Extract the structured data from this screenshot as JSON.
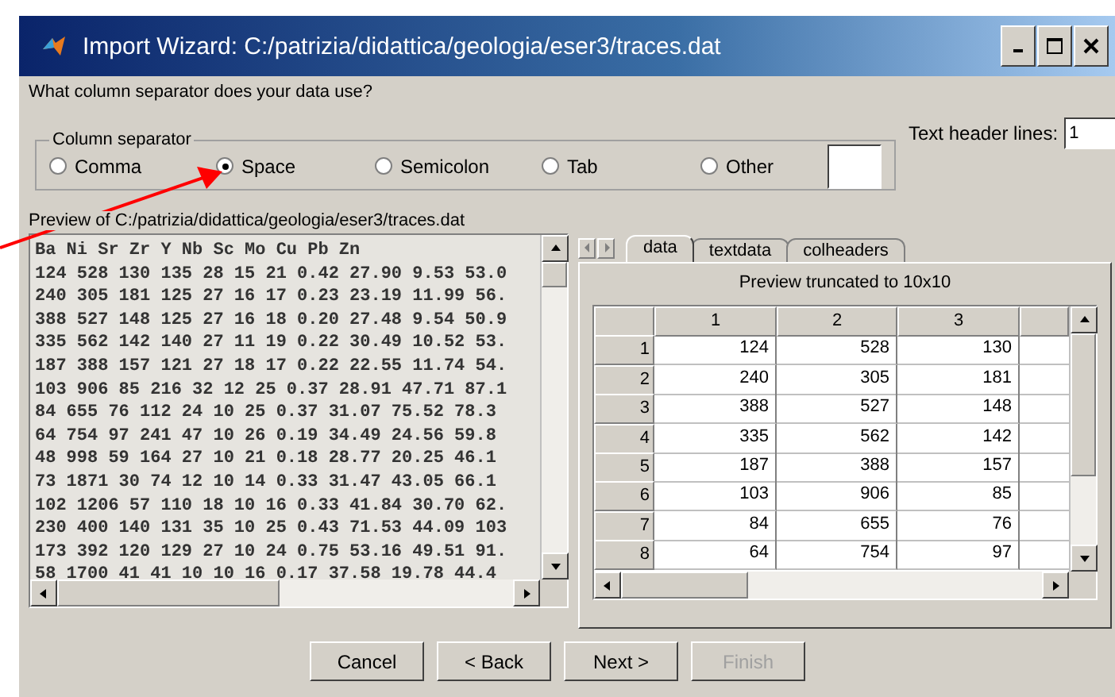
{
  "window": {
    "title": "Import Wizard: C:/patrizia/didattica/geologia/eser3/traces.dat"
  },
  "question": "What column separator does your data use?",
  "separator": {
    "label": "Column separator",
    "options": [
      {
        "label": "Comma",
        "selected": false
      },
      {
        "label": "Space",
        "selected": true
      },
      {
        "label": "Semicolon",
        "selected": false
      },
      {
        "label": "Tab",
        "selected": false
      },
      {
        "label": "Other",
        "selected": false
      }
    ]
  },
  "header_lines": {
    "label": "Text header lines:",
    "value": "1"
  },
  "preview": {
    "label": "Preview of C:/patrizia/didattica/geologia/eser3/traces.dat",
    "lines": [
      "Ba Ni Sr Zr Y Nb Sc Mo Cu Pb Zn",
      "124 528 130 135 28 15 21 0.42 27.90 9.53 53.0",
      "240 305 181 125 27 16 17 0.23 23.19 11.99 56.",
      "388 527 148 125 27 16 18 0.20 27.48 9.54 50.9",
      "335 562 142 140 27 11 19 0.22 30.49 10.52 53.",
      "187 388 157 121 27 18 17 0.22 22.55 11.74 54.",
      "103 906 85 216 32 12 25 0.37 28.91 47.71 87.1",
      "84 655 76 112 24 10 25 0.37 31.07 75.52 78.3",
      "64 754 97 241 47 10 26 0.19 34.49 24.56 59.8",
      "48 998 59 164 27 10 21 0.18 28.77 20.25 46.1",
      "73 1871 30 74 12 10 14 0.33 31.47 43.05 66.1",
      "102 1206 57 110 18 10 16 0.33 41.84 30.70 62.",
      "230 400 140 131 35 10 25 0.43 71.53 44.09 103",
      "173 392 120 129 27 10 24 0.75 53.16 49.51 91.",
      "58 1700 41 41 10 10 16 0.17 37.58 19.78 44.4"
    ]
  },
  "tabs": [
    {
      "label": "data",
      "selected": true
    },
    {
      "label": "textdata",
      "selected": false
    },
    {
      "label": "colheaders",
      "selected": false
    }
  ],
  "table": {
    "caption": "Preview truncated to 10x10",
    "columns": [
      "1",
      "2",
      "3"
    ],
    "rows": [
      {
        "header": "1",
        "cells": [
          "124",
          "528",
          "130"
        ]
      },
      {
        "header": "2",
        "cells": [
          "240",
          "305",
          "181"
        ]
      },
      {
        "header": "3",
        "cells": [
          "388",
          "527",
          "148"
        ]
      },
      {
        "header": "4",
        "cells": [
          "335",
          "562",
          "142"
        ]
      },
      {
        "header": "5",
        "cells": [
          "187",
          "388",
          "157"
        ]
      },
      {
        "header": "6",
        "cells": [
          "103",
          "906",
          "85"
        ]
      },
      {
        "header": "7",
        "cells": [
          "84",
          "655",
          "76"
        ]
      },
      {
        "header": "8",
        "cells": [
          "64",
          "754",
          "97"
        ]
      }
    ]
  },
  "buttons": [
    {
      "label": "Cancel",
      "disabled": false
    },
    {
      "label": "< Back",
      "disabled": false
    },
    {
      "label": "Next >",
      "disabled": false
    },
    {
      "label": "Finish",
      "disabled": true
    }
  ]
}
